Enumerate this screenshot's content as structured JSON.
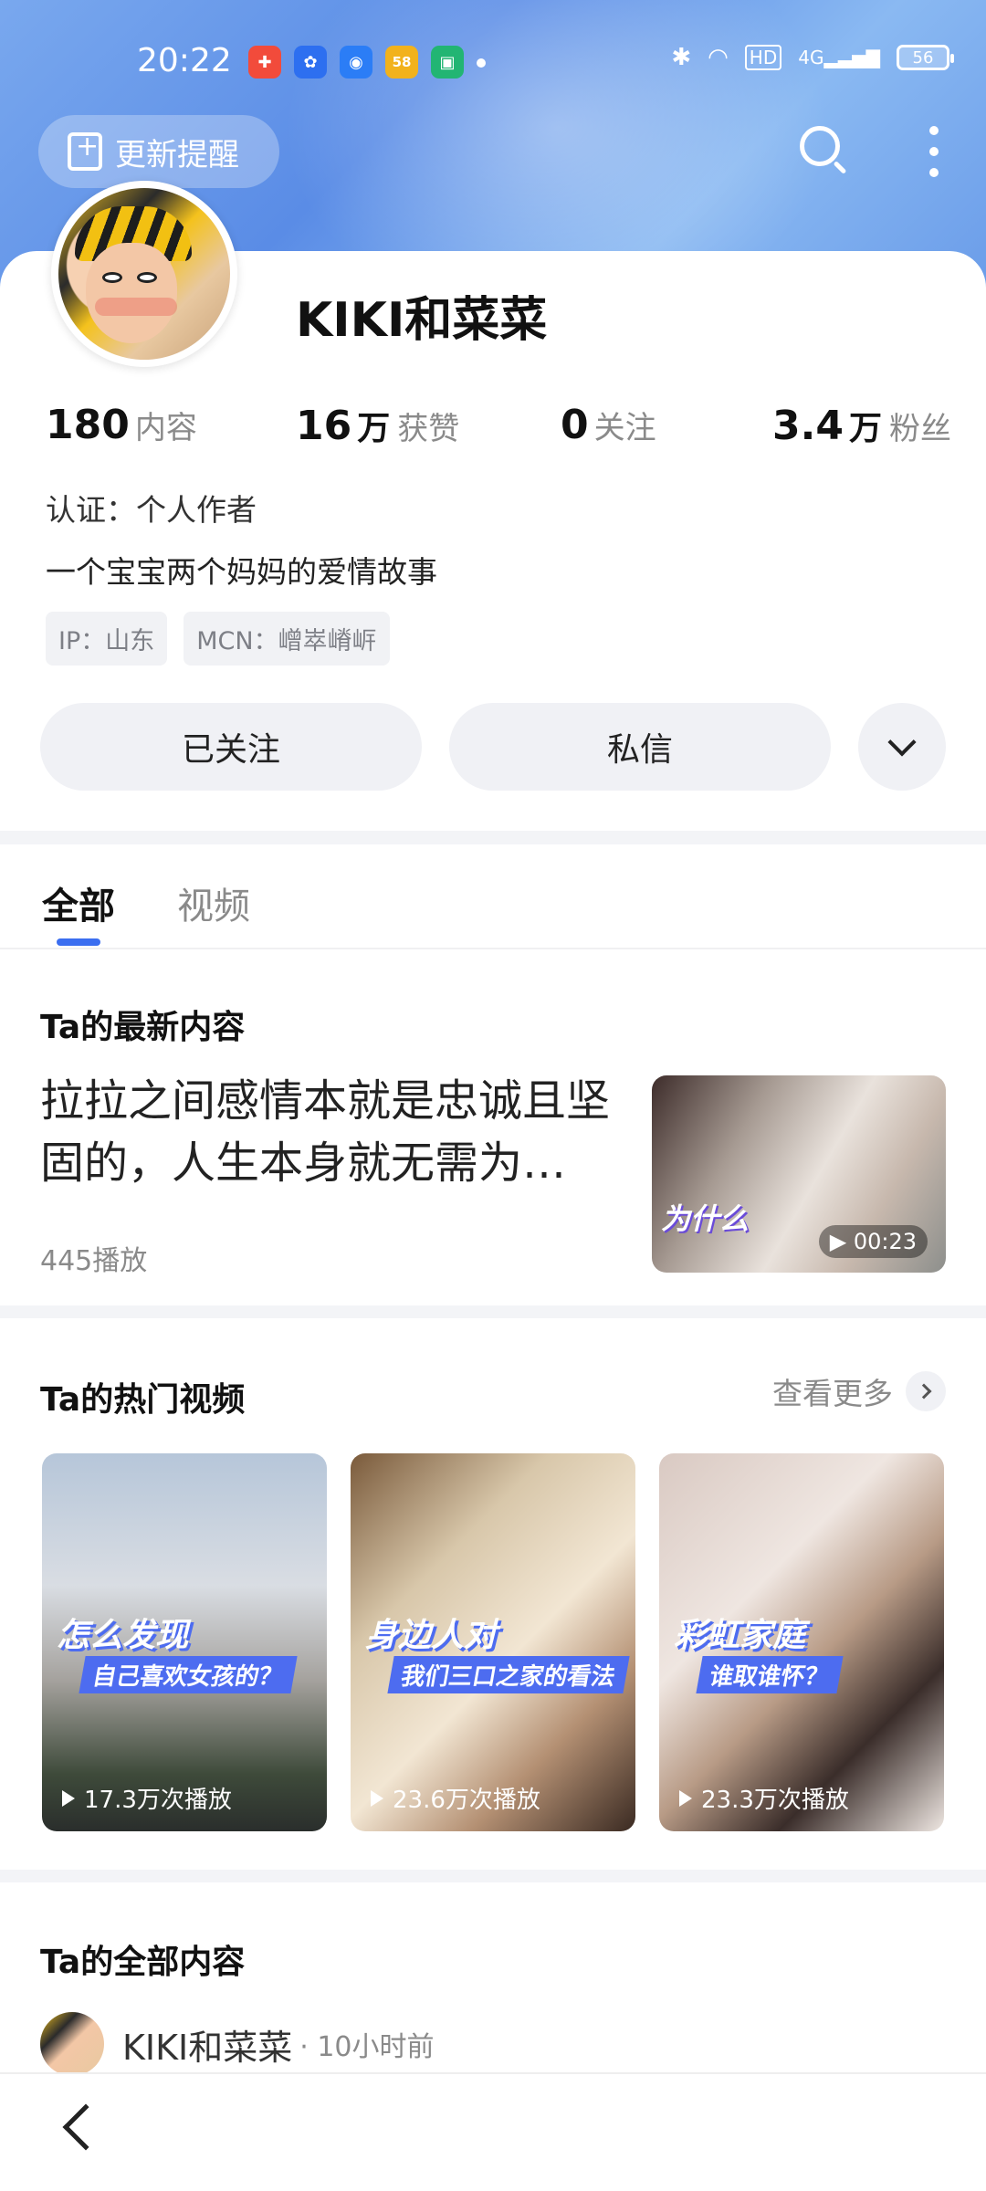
{
  "status_bar": {
    "time": "20:22",
    "app_icons": [
      {
        "name": "app1-icon",
        "color": "#f24b3b",
        "glyph": "✚"
      },
      {
        "name": "baidu-icon",
        "color": "#2d6ff0",
        "glyph": "✿"
      },
      {
        "name": "qq-browser-icon",
        "color": "#2b7df6",
        "glyph": "◉"
      },
      {
        "name": "app58-icon",
        "color": "#f2b21c",
        "glyph": "58"
      },
      {
        "name": "app-green-icon",
        "color": "#22b573",
        "glyph": "▣"
      }
    ],
    "battery": "56"
  },
  "header": {
    "update_reminder": "更新提醒"
  },
  "profile": {
    "name": "KIKI和菜菜",
    "stats": [
      {
        "value": "180",
        "unit": "",
        "label": "内容"
      },
      {
        "value": "16",
        "unit": "万",
        "label": "获赞"
      },
      {
        "value": "0",
        "unit": "",
        "label": "关注"
      },
      {
        "value": "3.4",
        "unit": "万",
        "label": "粉丝"
      }
    ],
    "certification": "认证：个人作者",
    "bio": "一个宝宝两个妈妈的爱情故事",
    "tags": [
      "IP：山东",
      "MCN：嶒崒嵴㟁"
    ],
    "follow_button": "已关注",
    "message_button": "私信"
  },
  "tabs": [
    {
      "label": "全部",
      "active": true
    },
    {
      "label": "视频",
      "active": false
    }
  ],
  "latest": {
    "title": "Ta的最新内容",
    "text": "拉拉之间感情本就是忠诚且坚固的，人生本身就无需为…",
    "plays": "445播放",
    "thumb_caption": "为什么",
    "duration": "00:23"
  },
  "hot": {
    "title": "Ta的热门视频",
    "see_more": "查看更多",
    "videos": [
      {
        "cap1": "怎么发现",
        "cap2": "自己喜欢女孩的？",
        "plays": "17.3万次播放"
      },
      {
        "cap1": "身边人对",
        "cap2": "我们三口之家的看法",
        "plays": "23.6万次播放"
      },
      {
        "cap1": "彩虹家庭",
        "cap2": "谁取谁怀？",
        "plays": "23.3万次播放"
      }
    ]
  },
  "all_content": {
    "title": "Ta的全部内容",
    "author": "KIKI和菜菜",
    "time": "· 10小时前"
  }
}
